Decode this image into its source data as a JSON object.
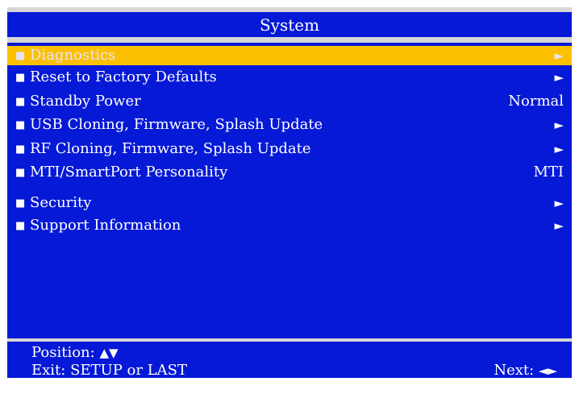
{
  "title": "System",
  "menu": {
    "items": [
      {
        "label": "Diagnostics",
        "value": "►",
        "selected": true
      },
      {
        "label": "Reset to Factory Defaults",
        "value": "►"
      },
      {
        "label": "Standby Power",
        "value": "Normal"
      },
      {
        "label": "USB Cloning, Firmware, Splash Update",
        "value": "►"
      },
      {
        "label": "RF Cloning, Firmware, Splash Update",
        "value": "►"
      },
      {
        "label": "MTI/SmartPort Personality",
        "value": "MTI"
      },
      {
        "label": "Security",
        "value": "►"
      },
      {
        "label": "Support Information",
        "value": "►"
      }
    ],
    "bullet": "■"
  },
  "footer": {
    "position_label": "Position:",
    "position_glyphs": "▲▼",
    "exit_label": "Exit: SETUP or LAST",
    "next_label": "Next:",
    "next_glyphs": "◄►"
  },
  "colors": {
    "background": "#0619d6",
    "highlight": "#fcc000",
    "separator": "#d6d6d6",
    "text": "#ffffff"
  }
}
